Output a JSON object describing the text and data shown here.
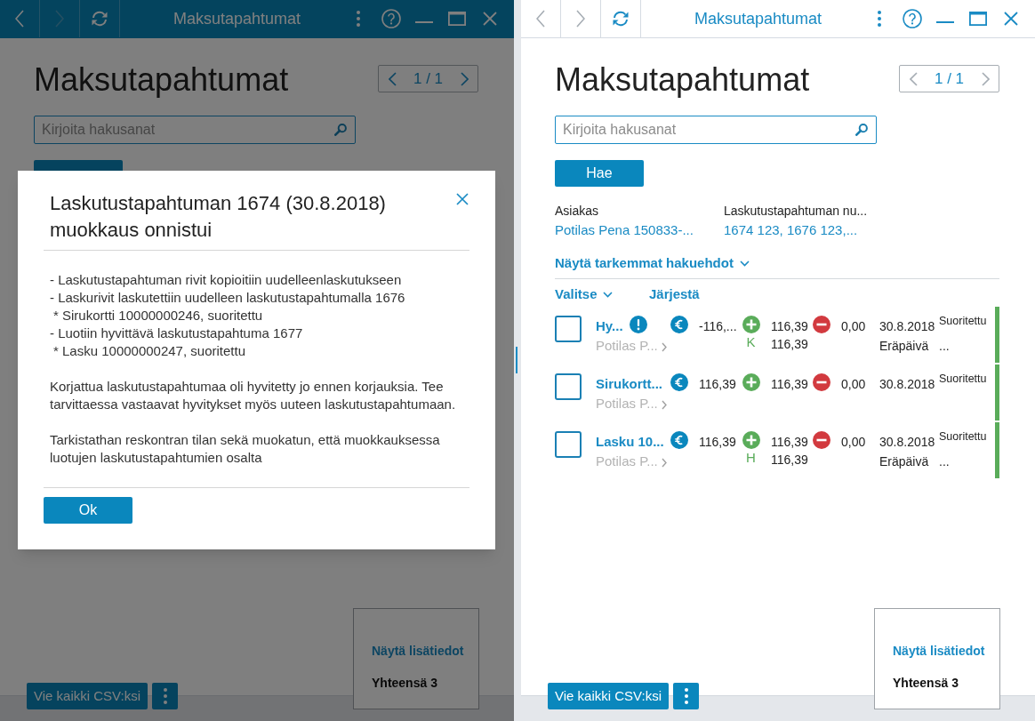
{
  "left_window": {
    "title_bar": {
      "title": "Maksutapahtumat",
      "focused": true,
      "back_disabled": false,
      "forward_disabled": true
    },
    "heading": "Maksutapahtumat",
    "pager": {
      "text": "1 / 1",
      "prev_disabled": false,
      "next_disabled": false
    },
    "search": {
      "placeholder": "Kirjoita hakusanat"
    },
    "export_button": "Vie kaikki CSV:ksi",
    "summary": {
      "link": "Näytä lisätiedot",
      "total": "Yhteensä 3"
    },
    "dialog": {
      "title": "Laskutustapahtuman 1674 (30.8.2018) muokkaus onnistui",
      "items": [
        {
          "text": "- Laskutustapahtuman rivit kopioitiin uudelleenlaskutukseen"
        },
        {
          "text": "- Laskurivit laskutettiin uudelleen laskutustapahtumalla 1676",
          "children": [
            {
              "text": "* Sirukortti 10000000246, suoritettu"
            }
          ]
        },
        {
          "text": "- Luotiin hyvittävä laskutustapahtuma 1677",
          "children": [
            {
              "text": "* Lasku 10000000247, suoritettu"
            }
          ]
        }
      ],
      "paragraphs": [
        "Korjattua laskutustapahtumaa oli hyvitetty jo ennen korjauksia. Tee tarvittaessa vastaavat hyvitykset myös uuteen laskutustapahtumaan.",
        "Tarkistathan reskontran tilan sekä muokatun, että muokkauksessa luotujen laskutustapahtumien osalta"
      ],
      "ok_button": "Ok"
    }
  },
  "right_window": {
    "title_bar": {
      "title": "Maksutapahtumat",
      "focused": false,
      "back_disabled": true,
      "forward_disabled": true
    },
    "heading": "Maksutapahtumat",
    "pager": {
      "text": "1 / 1",
      "prev_disabled": true,
      "next_disabled": true
    },
    "search": {
      "placeholder": "Kirjoita hakusanat"
    },
    "search_button": "Hae",
    "filters": [
      {
        "label": "Asiakas",
        "value": "Potilas Pena 150833-..."
      },
      {
        "label": "Laskutustapahtuman nu...",
        "value": "1674 123, 1676 123,..."
      }
    ],
    "more_filters_link": "Näytä tarkemmat hakuehdot",
    "select_menu": "Valitse",
    "sort_link": "Järjestä",
    "rows": [
      {
        "checked": false,
        "title": "Hy...",
        "warning": true,
        "subtitle": "Potilas P...",
        "euro_amount": "-116,...",
        "plus_note": "K",
        "plus_amounts": [
          "116,39",
          "116,39"
        ],
        "minus_amount": "0,00",
        "date": "30.8.2018",
        "due_label": "Eräpäivä",
        "due_value": "...",
        "status": "Suoritettu",
        "color": "#5aac5a"
      },
      {
        "checked": false,
        "title": "Sirukortt...",
        "warning": false,
        "subtitle": "Potilas P...",
        "euro_amount": "116,39",
        "plus_amounts": [
          "116,39"
        ],
        "minus_amount": "0,00",
        "date": "30.8.2018",
        "status": "Suoritettu",
        "color": "#5aac5a"
      },
      {
        "checked": false,
        "title": "Lasku 10...",
        "warning": false,
        "subtitle": "Potilas P...",
        "euro_amount": "116,39",
        "plus_note": "H",
        "plus_amounts": [
          "116,39",
          "116,39"
        ],
        "minus_amount": "0,00",
        "date": "30.8.2018",
        "due_label": "Eräpäivä",
        "due_value": "...",
        "status": "Suoritettu",
        "color": "#5aac5a"
      }
    ],
    "export_button": "Vie kaikki CSV:ksi",
    "summary": {
      "link": "Näytä lisätiedot",
      "total": "Yhteensä 3"
    }
  }
}
